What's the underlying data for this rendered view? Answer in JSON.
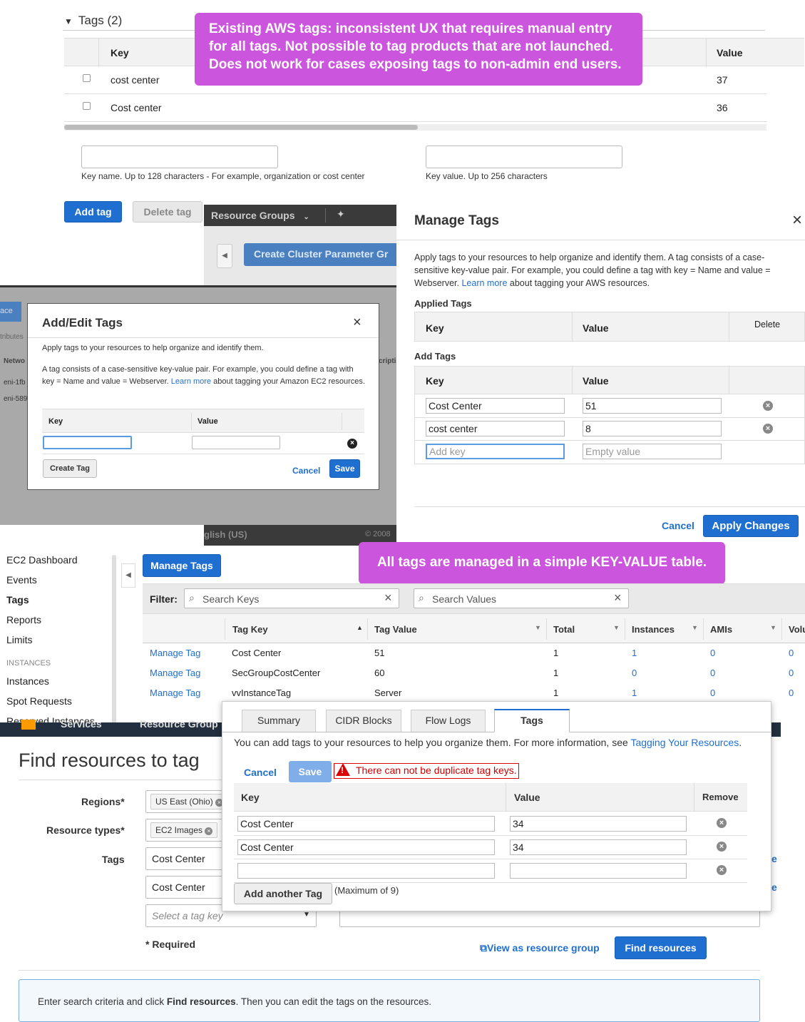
{
  "panel1": {
    "section_toggle": "Tags (2)",
    "col_key": "Key",
    "col_value": "Value",
    "rows": [
      {
        "key": "cost center",
        "value": "37"
      },
      {
        "key": "Cost center",
        "value": "36"
      }
    ],
    "key_hint": "Key name. Up to 128 characters - For example, organization or cost center",
    "value_hint": "Key value. Up to 256 characters",
    "add_btn": "Add tag",
    "delete_btn": "Delete tag"
  },
  "callout1": "Existing AWS tags: inconsistent UX that requires manual entry for all tags. Not possible to tag products that are not launched. Does not work for cases exposing tags to non-admin end users.",
  "rds_bg": {
    "nav": "Resource Groups",
    "button": "Create Cluster Parameter Gr",
    "footer": "glish (US)",
    "copyright": "© 2008"
  },
  "ec2_bg": {
    "tab": "ace",
    "cells": [
      "tributes",
      "Netwo",
      "eni-1fb",
      "eni-589",
      "cription"
    ]
  },
  "addedit": {
    "title": "Add/Edit Tags",
    "desc1": "Apply tags to your resources to help organize and identify them.",
    "desc2a": "A tag consists of a case-sensitive key-value pair. For example, you could define a tag with key = Name and value = Webserver.",
    "learn": "Learn more",
    "desc2b": "about tagging your Amazon EC2 resources.",
    "col_key": "Key",
    "col_value": "Value",
    "create": "Create Tag",
    "cancel": "Cancel",
    "save": "Save"
  },
  "manage": {
    "title": "Manage Tags",
    "desc_a": "Apply tags to your resources to help organize and identify them. A tag consists of a case-sensitive key-value pair. For example, you could define a tag with key = Name and value = Webserver.",
    "learn": "Learn more",
    "desc_b": "about tagging your AWS resources.",
    "applied": "Applied Tags",
    "col_key": "Key",
    "col_value": "Value",
    "col_delete": "Delete",
    "add": "Add Tags",
    "rows": [
      {
        "key": "Cost Center",
        "value": "51"
      },
      {
        "key": "cost center",
        "value": "8"
      }
    ],
    "new_key_placeholder": "Add key",
    "new_value_placeholder": "Empty value",
    "cancel": "Cancel",
    "apply": "Apply Changes"
  },
  "callout2": "All tags are managed in a simple KEY-VALUE table.",
  "ec2tags": {
    "sidebar": [
      "EC2 Dashboard",
      "Events",
      "Tags",
      "Reports",
      "Limits"
    ],
    "instances_header": "INSTANCES",
    "sidebar2": [
      "Instances",
      "Spot Requests",
      "Reserved Instances"
    ],
    "manage_btn": "Manage Tags",
    "filter_label": "Filter:",
    "search_keys": "Search Keys",
    "search_values": "Search Values",
    "cols": [
      "Tag Key",
      "Tag Value",
      "Total",
      "Instances",
      "AMIs",
      "Volu"
    ],
    "rows": [
      {
        "link": "Manage Tag",
        "key": "Cost Center",
        "value": "51",
        "total": "1",
        "instances": "1",
        "amis": "0",
        "vol": "0"
      },
      {
        "link": "Manage Tag",
        "key": "SecGroupCostCenter",
        "value": "60",
        "total": "1",
        "instances": "0",
        "amis": "0",
        "vol": "0"
      },
      {
        "link": "Manage Tag",
        "key": "vvInstanceTag",
        "value": "Server",
        "total": "1",
        "instances": "1",
        "amis": "0",
        "vol": "0"
      }
    ]
  },
  "find": {
    "topbar1": "Services",
    "topbar2": "Resource Group",
    "title": "Find resources to tag",
    "regions_label": "Regions*",
    "region_chip": "US East (Ohio)",
    "types_label": "Resource types*",
    "type_chip": "EC2 Images",
    "tags_label": "Tags",
    "tag1": "Cost Center",
    "tag2": "Cost Center",
    "tag_select": "Select a tag key",
    "required": "* Required",
    "view_group": "View as resource group",
    "find_btn": "Find resources",
    "info_a": "Enter search criteria and click",
    "info_b": "Find resources",
    "info_c": ". Then you can edit the tags on the resources."
  },
  "vpc": {
    "tabs": [
      "Summary",
      "CIDR Blocks",
      "Flow Logs",
      "Tags"
    ],
    "desc": "You can add tags to your resources to help you organize them. For more information, see",
    "link": "Tagging Your Resources",
    "period": ".",
    "cancel": "Cancel",
    "save": "Save",
    "error": "There can not be duplicate tag keys.",
    "col_key": "Key",
    "col_value": "Value",
    "col_remove": "Remove",
    "rows": [
      {
        "key": "Cost Center",
        "value": "34"
      },
      {
        "key": "Cost Center",
        "value": "34"
      },
      {
        "key": "",
        "value": ""
      }
    ],
    "add_btn": "Add another Tag",
    "max": "(Maximum of 9)"
  }
}
